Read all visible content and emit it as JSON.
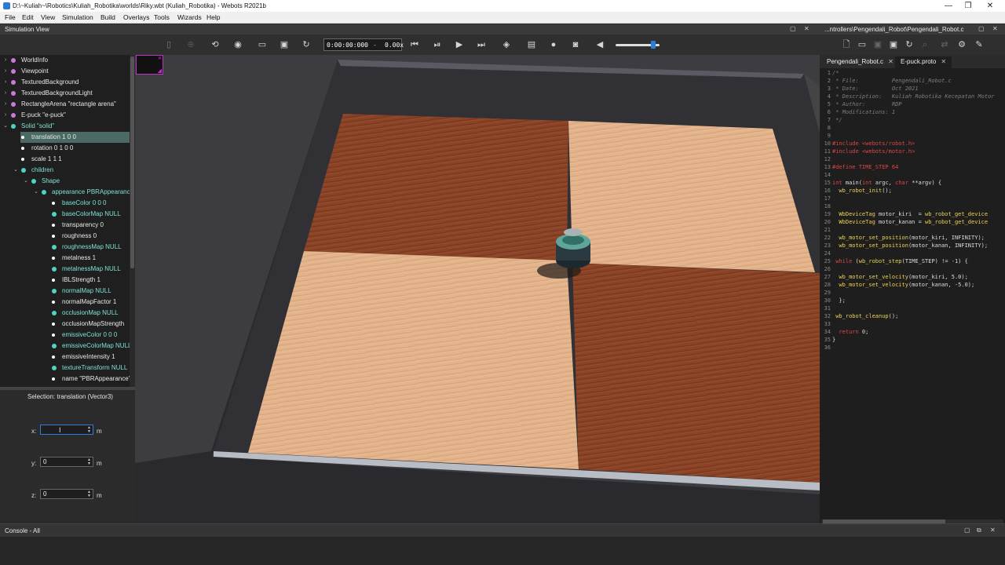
{
  "window": {
    "title": "D:\\~Kuliah~\\Robotics\\Kuliah_Robotika\\worlds\\Riky.wbt (Kuliah_Robotika) - Webots R2021b",
    "minimize": "—",
    "maximize": "❐",
    "close": "✕"
  },
  "menu": [
    "File",
    "Edit",
    "View",
    "Simulation",
    "Build",
    "Overlays",
    "Tools",
    "Wizards",
    "Help"
  ],
  "dock_left": {
    "title": "Simulation View",
    "restore": "▢",
    "close": "✕"
  },
  "dock_right": {
    "title": "...ntrollers\\Pengendali_Robot\\Pengendali_Robot.c",
    "restore": "▢",
    "close": "✕"
  },
  "toolbar": {
    "time": "0:00:00:000",
    "speed": "0.00x",
    "step": "-",
    "volume_percent": 90
  },
  "scene_tree": [
    {
      "label": "WorldInfo",
      "depth": 0,
      "arrow": "›",
      "dot": "#c77bd4"
    },
    {
      "label": "Viewpoint",
      "depth": 0,
      "arrow": "›",
      "dot": "#c77bd4"
    },
    {
      "label": "TexturedBackground",
      "depth": 0,
      "arrow": "›",
      "dot": "#c77bd4"
    },
    {
      "label": "TexturedBackgroundLight",
      "depth": 0,
      "arrow": "›",
      "dot": "#c77bd4"
    },
    {
      "label": "RectangleArena \"rectangle arena\"",
      "depth": 0,
      "arrow": "›",
      "dot": "#c77bd4"
    },
    {
      "label": "E-puck \"e-puck\"",
      "depth": 0,
      "arrow": "›",
      "dot": "#c77bd4"
    },
    {
      "label": "Solid \"solid\"",
      "depth": 0,
      "arrow": "⌄",
      "dot": "#4fd3c4"
    },
    {
      "label": "translation 1 0 0",
      "depth": 1,
      "arrow": "",
      "dot": "#ffffff",
      "selected": true
    },
    {
      "label": "rotation 0 1 0 0",
      "depth": 1,
      "arrow": "",
      "dot": "#ffffff"
    },
    {
      "label": "scale 1 1 1",
      "depth": 1,
      "arrow": "",
      "dot": "#ffffff"
    },
    {
      "label": "children",
      "depth": 1,
      "arrow": "⌄",
      "dot": "#4fd3c4"
    },
    {
      "label": "Shape",
      "depth": 2,
      "arrow": "⌄",
      "dot": "#4fd3c4"
    },
    {
      "label": "appearance PBRAppearance",
      "depth": 3,
      "arrow": "⌄",
      "dot": "#4fd3c4"
    },
    {
      "label": "baseColor 0 0 0",
      "depth": 4,
      "arrow": "",
      "dot": "#ffffff"
    },
    {
      "label": "baseColorMap NULL",
      "depth": 4,
      "arrow": "",
      "dot": "#4fd3c4"
    },
    {
      "label": "transparency 0",
      "depth": 4,
      "arrow": "",
      "dot": "#ffffff"
    },
    {
      "label": "roughness 0",
      "depth": 4,
      "arrow": "",
      "dot": "#ffffff"
    },
    {
      "label": "roughnessMap NULL",
      "depth": 4,
      "arrow": "",
      "dot": "#4fd3c4"
    },
    {
      "label": "metalness 1",
      "depth": 4,
      "arrow": "",
      "dot": "#ffffff"
    },
    {
      "label": "metalnessMap NULL",
      "depth": 4,
      "arrow": "",
      "dot": "#4fd3c4"
    },
    {
      "label": "IBLStrength 1",
      "depth": 4,
      "arrow": "",
      "dot": "#ffffff"
    },
    {
      "label": "normalMap NULL",
      "depth": 4,
      "arrow": "",
      "dot": "#4fd3c4"
    },
    {
      "label": "normalMapFactor 1",
      "depth": 4,
      "arrow": "",
      "dot": "#ffffff"
    },
    {
      "label": "occlusionMap NULL",
      "depth": 4,
      "arrow": "",
      "dot": "#4fd3c4"
    },
    {
      "label": "occlusionMapStrength",
      "depth": 4,
      "arrow": "",
      "dot": "#ffffff"
    },
    {
      "label": "emissiveColor 0 0 0",
      "depth": 4,
      "arrow": "",
      "dot": "#ffffff"
    },
    {
      "label": "emissiveColorMap NULL",
      "depth": 4,
      "arrow": "",
      "dot": "#4fd3c4"
    },
    {
      "label": "emissiveIntensity 1",
      "depth": 4,
      "arrow": "",
      "dot": "#ffffff"
    },
    {
      "label": "textureTransform NULL",
      "depth": 4,
      "arrow": "",
      "dot": "#4fd3c4"
    },
    {
      "label": "name \"PBRAppearance\"",
      "depth": 4,
      "arrow": "",
      "dot": "#ffffff"
    }
  ],
  "field_editor": {
    "selection": "Selection: translation (Vector3)",
    "x": {
      "label": "x:",
      "value": "",
      "unit": "m"
    },
    "y": {
      "label": "y:",
      "value": "0",
      "unit": "m"
    },
    "z": {
      "label": "z:",
      "value": "0",
      "unit": "m"
    }
  },
  "editor": {
    "tabs": [
      {
        "label": "Pengendali_Robot.c",
        "close": "✕",
        "active": false
      },
      {
        "label": "E-puck.proto",
        "close": "✕",
        "active": true
      }
    ],
    "code": [
      [
        {
          "t": "/*",
          "c": "com"
        }
      ],
      [
        {
          "t": " * File:          Pengendali_Robot.c",
          "c": "com"
        }
      ],
      [
        {
          "t": " * Date:          Oct 2021",
          "c": "com"
        }
      ],
      [
        {
          "t": " * Description:   Kuliah Robotika Kecepatan Motor",
          "c": "com"
        }
      ],
      [
        {
          "t": " * Author:        RDP",
          "c": "com"
        }
      ],
      [
        {
          "t": " * Modifications: 1",
          "c": "com"
        }
      ],
      [
        {
          "t": " */",
          "c": "com"
        }
      ],
      [],
      [],
      [
        {
          "t": "#include <webots/robot.h>",
          "c": "pre"
        }
      ],
      [
        {
          "t": "#include <webots/motor.h>",
          "c": "pre"
        }
      ],
      [],
      [
        {
          "t": "#define TIME_STEP 64",
          "c": "pre"
        }
      ],
      [],
      [
        {
          "t": "int",
          "c": "kw"
        },
        {
          "t": " main(",
          "c": ""
        },
        {
          "t": "int",
          "c": "kw"
        },
        {
          "t": " argc, ",
          "c": ""
        },
        {
          "t": "char",
          "c": "kw"
        },
        {
          "t": " **argv) {",
          "c": ""
        }
      ],
      [
        {
          "t": "  wb_robot_init",
          "c": "fn"
        },
        {
          "t": "();",
          "c": ""
        }
      ],
      [],
      [],
      [
        {
          "t": "  WbDeviceTag",
          "c": "fn"
        },
        {
          "t": " motor_kiri  = ",
          "c": ""
        },
        {
          "t": "wb_robot_get_device",
          "c": "fn"
        }
      ],
      [
        {
          "t": "  WbDeviceTag",
          "c": "fn"
        },
        {
          "t": " motor_kanan = ",
          "c": ""
        },
        {
          "t": "wb_robot_get_device",
          "c": "fn"
        }
      ],
      [],
      [
        {
          "t": "  wb_motor_set_position",
          "c": "fn"
        },
        {
          "t": "(motor_kiri, INFINITY);",
          "c": ""
        }
      ],
      [
        {
          "t": "  wb_motor_set_position",
          "c": "fn"
        },
        {
          "t": "(motor_kanan, INFINITY);",
          "c": ""
        }
      ],
      [],
      [
        {
          "t": " while",
          "c": "kw"
        },
        {
          "t": " (",
          "c": ""
        },
        {
          "t": "wb_robot_step",
          "c": "fn"
        },
        {
          "t": "(TIME_STEP) != -1) {",
          "c": ""
        }
      ],
      [],
      [
        {
          "t": "  wb_motor_set_velocity",
          "c": "fn"
        },
        {
          "t": "(motor_kiri, 5.0);",
          "c": ""
        }
      ],
      [
        {
          "t": "  wb_motor_set_velocity",
          "c": "fn"
        },
        {
          "t": "(motor_kanan, -5.0);",
          "c": ""
        }
      ],
      [],
      [
        {
          "t": "  };",
          "c": ""
        }
      ],
      [],
      [
        {
          "t": " wb_robot_cleanup",
          "c": "fn"
        },
        {
          "t": "();",
          "c": ""
        }
      ],
      [],
      [
        {
          "t": "  return",
          "c": "kw"
        },
        {
          "t": " 0;",
          "c": ""
        }
      ],
      [
        {
          "t": "}",
          "c": ""
        }
      ],
      []
    ]
  },
  "console": {
    "title": "Console - All",
    "restore": "▢",
    "float": "⧉",
    "close": "✕"
  }
}
